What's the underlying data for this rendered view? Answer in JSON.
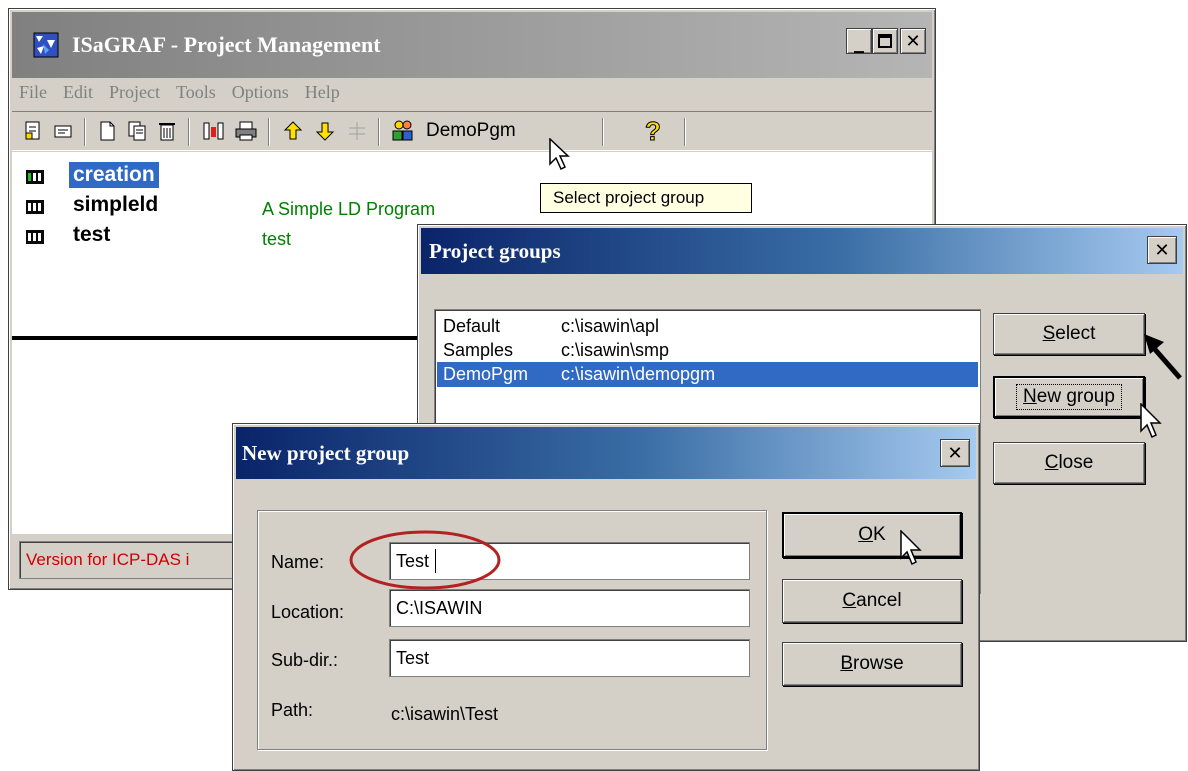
{
  "main_window": {
    "title": "ISaGRAF - Project Management",
    "menu": [
      "File",
      "Edit",
      "Project",
      "Tools",
      "Options",
      "Help"
    ],
    "toolbar": {
      "group_name": "DemoPgm",
      "tooltip": "Select project group"
    },
    "projects": [
      {
        "name": "creation",
        "comment": "",
        "selected": true
      },
      {
        "name": "simpleld",
        "comment": "A Simple LD Program",
        "selected": false
      },
      {
        "name": "test",
        "comment": "test",
        "selected": false
      }
    ],
    "status_text": "Version for ICP-DAS i"
  },
  "project_groups_dialog": {
    "title": "Project groups",
    "groups": [
      {
        "name": "Default",
        "path": "c:\\isawin\\apl",
        "selected": false
      },
      {
        "name": "Samples",
        "path": "c:\\isawin\\smp",
        "selected": false
      },
      {
        "name": "DemoPgm",
        "path": "c:\\isawin\\demopgm",
        "selected": true
      }
    ],
    "buttons": {
      "select_first": "S",
      "select_rest": "elect",
      "new_group_first": "N",
      "new_group_rest": "ew group",
      "close_first": "C",
      "close_rest": "lose"
    }
  },
  "new_group_dialog": {
    "title": "New project group",
    "fields": {
      "name_label": "Name:",
      "name_value": "Test",
      "location_label": "Location:",
      "location_value": "C:\\ISAWIN",
      "subdir_label": "Sub-dir.:",
      "subdir_value": "Test",
      "path_label": "Path:",
      "path_value": "c:\\isawin\\Test"
    },
    "buttons": {
      "ok_first": "O",
      "ok_rest": "K",
      "cancel_first": "C",
      "cancel_rest": "ancel",
      "browse_first": "B",
      "browse_rest": "rowse"
    }
  },
  "colors": {
    "title_active": "#0a246a",
    "selection": "#316ac5",
    "comment_green": "#008000",
    "status_red": "#d00000",
    "annotation_circle": "#b22222"
  }
}
